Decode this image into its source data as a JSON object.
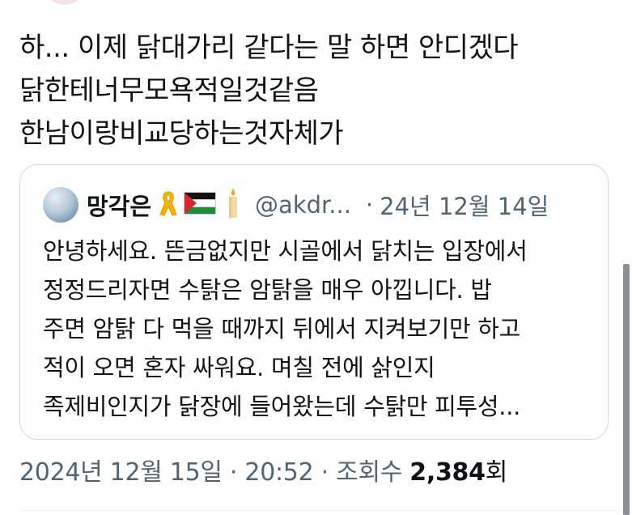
{
  "tweet": {
    "lines": [
      "하... 이제 닭대가리 같다는 말 하면 안디겠다",
      "닭한테너무모욕적일것같음",
      "한남이랑비교당하는것자체가"
    ]
  },
  "quote": {
    "author_name": "망각은",
    "handle": "@akdr...",
    "separator": "·",
    "date": "24년 12월 14일",
    "icons": [
      "yellow-ribbon-icon",
      "palestine-flag-icon",
      "candle-icon"
    ],
    "lines": [
      "안녕하세요. 뜬금없지만 시골에서 닭치는 입장에서",
      "정정드리자면 수탉은 암탉을 매우 아낍니다. 밥",
      "주면 암탉 다 먹을 때까지 뒤에서 지켜보기만 하고",
      "적이 오면 혼자 싸워요. 며칠 전에 삵인지",
      "족제비인지가 닭장에 들어왔는데 수탉만 피투성..."
    ]
  },
  "meta": {
    "date": "2024년 12월 15일",
    "sep1": "·",
    "time": "20:52",
    "sep2": "·",
    "views_prefix": "조회수",
    "views_count": "2,384",
    "views_suffix": "회"
  },
  "colors": {
    "text": "#0f1419",
    "secondary": "#536471",
    "border": "#cfd9de",
    "ribbon": "#f4b400",
    "flag_green": "#1e8c3a",
    "flag_red": "#d9232d"
  }
}
